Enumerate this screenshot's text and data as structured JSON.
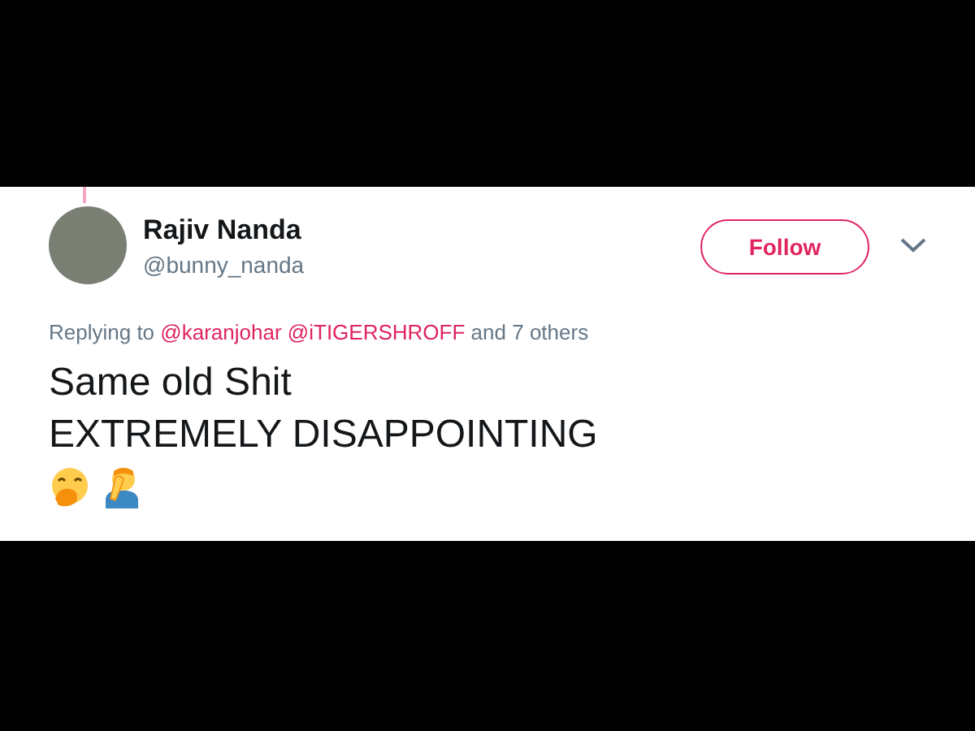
{
  "tweet": {
    "author": {
      "name": "Rajiv Nanda",
      "handle": "@bunny_nanda"
    },
    "follow_button": {
      "label": "Follow"
    },
    "replying": {
      "prefix": "Replying to",
      "mentions": [
        "@karanjohar",
        "@iTIGERSHROFF"
      ],
      "suffix": "and 7 others"
    },
    "text_lines": [
      "Same old Shit",
      "EXTREMELY DISAPPOINTING"
    ]
  }
}
